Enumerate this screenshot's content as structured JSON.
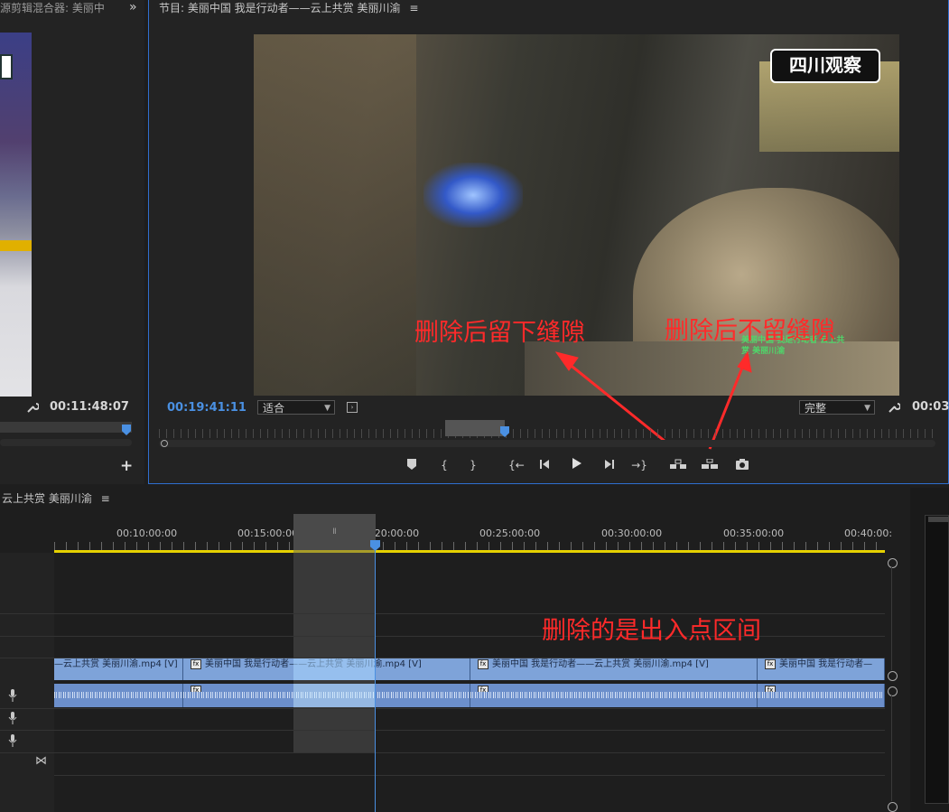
{
  "source_panel": {
    "title": "源剪辑混合器: 美丽中",
    "timecode": "00:11:48:07"
  },
  "program_panel": {
    "title": "节目: 美丽中国 我是行动者——云上共赏 美丽川渝",
    "timecode": "00:19:41:11",
    "fit_select": "适合",
    "quality_select": "完整",
    "right_timecode_partial": "00:03:",
    "logo_text": "四川观察",
    "inner_overlay_text": "美丽中国 我是行动者 云上共赏 美丽川渝"
  },
  "annotations": {
    "lift": "删除后留下缝隙",
    "extract": "删除后不留缝隙",
    "range": "删除的是出入点区间"
  },
  "timeline": {
    "title": "云上共赏 美丽川渝",
    "ruler": [
      "00:10:00:00",
      "00:15:00:00",
      "00:20:00:00",
      "00:25:00:00",
      "00:30:00:00",
      "00:35:00:00",
      "00:40:00:"
    ],
    "clips": [
      {
        "label": "—云上共赏 美丽川渝.mp4 [V]",
        "fx": false
      },
      {
        "label": "美丽中国 我是行动者——云上共赏 美丽川渝.mp4 [V]",
        "fx": true
      },
      {
        "label": "美丽中国 我是行动者——云上共赏 美丽川渝.mp4 [V]",
        "fx": true
      },
      {
        "label": "美丽中国 我是行动者—",
        "fx": true
      }
    ]
  },
  "icons": {
    "menu": "≡",
    "more": "»",
    "wrench": "🔧",
    "plus": "+",
    "marker": "⬟",
    "mark_in": "{",
    "mark_out": "}",
    "go_in": "{←",
    "step_back": "◀|",
    "play": "▶",
    "step_fwd": "|▶",
    "go_out": "→}",
    "lift": "lift-icon",
    "extract": "extract-icon",
    "camera": "📷",
    "mic": "🎙",
    "bowtie": "⋈"
  },
  "colors": {
    "accent_blue": "#4a90e2",
    "annotation_red": "#ff2a2a",
    "clip_video": "#7ea3d9",
    "clip_audio": "#6c8fcb",
    "work_area": "#e5d100"
  }
}
